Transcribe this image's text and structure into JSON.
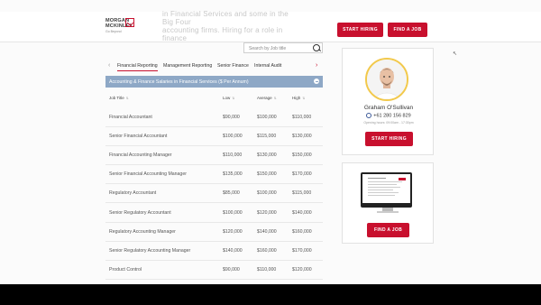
{
  "header": {
    "ghost_lines": [
      "in Financial Services and some in the Big Four",
      "accounting firms. Hiring for a role in finance"
    ],
    "logo": {
      "line1": "MORGAN",
      "line2": "MCKINLEY",
      "line3": "Go Beyond"
    },
    "start_hiring": "START HIRING",
    "find_a_job": "FIND A JOB"
  },
  "search": {
    "placeholder": "Search by Job title",
    "icon": "search-icon"
  },
  "tabs": [
    "Financial Reporting",
    "Management Reporting",
    "Senior Finance",
    "Internal Audit"
  ],
  "table": {
    "title": "Accounting & Finance Salaries in Financial Services ($ Per Annum)",
    "columns": [
      "Job Title",
      "Low",
      "Average",
      "High"
    ],
    "rows": [
      [
        "Financial Accountant",
        "$90,000",
        "$100,000",
        "$110,000"
      ],
      [
        "Senior Financial Accountant",
        "$100,000",
        "$115,000",
        "$130,000"
      ],
      [
        "Financial Accounting Manager",
        "$110,000",
        "$130,000",
        "$150,000"
      ],
      [
        "Senior Financial Accounting Manager",
        "$135,000",
        "$150,000",
        "$170,000"
      ],
      [
        "Regulatory Accountant",
        "$85,000",
        "$100,000",
        "$115,000"
      ],
      [
        "Senior Regulatory Accountant",
        "$100,000",
        "$120,000",
        "$140,000"
      ],
      [
        "Regulatory Accounting Manager",
        "$120,000",
        "$140,000",
        "$160,000"
      ],
      [
        "Senior Regulatory Accounting Manager",
        "$140,000",
        "$160,000",
        "$170,000"
      ],
      [
        "Product Control",
        "$90,000",
        "$110,000",
        "$120,000"
      ]
    ]
  },
  "contact": {
    "name": "Graham O'Sullivan",
    "phone": "+61 280 156 829",
    "hours": "Opening hours: 09:00am - 17:30pm",
    "start_hiring": "START HIRING"
  },
  "jobs_card": {
    "find_a_job": "FIND A JOB"
  },
  "colors": {
    "brand_red": "#c8102e",
    "table_header": "#8ea8c6",
    "avatar_ring": "#f2c94c"
  }
}
